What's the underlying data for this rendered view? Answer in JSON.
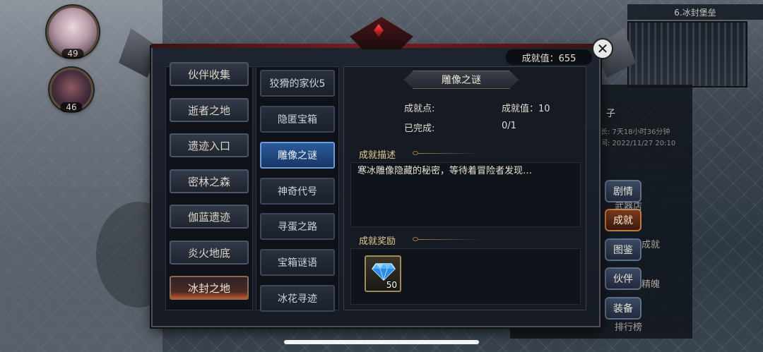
{
  "hud": {
    "avatar_levels": [
      "49",
      "46"
    ],
    "map_title": "6.冰封堡垒"
  },
  "side": {
    "partial_name": "子",
    "info_line1": "长: 7天18小时36分钟",
    "info_line2": "间: 2022/11/27 20:10",
    "buttons": [
      "剧情",
      "成就",
      "图鉴",
      "伙伴",
      "装备"
    ],
    "labels": [
      "武器店",
      "成就",
      "精魄",
      "排行榜"
    ]
  },
  "dialog": {
    "score": "成就值：655",
    "zones": [
      "伙伴收集",
      "逝者之地",
      "遗迹入口",
      "密林之森",
      "伽蓝遗迹",
      "炎火地底",
      "冰封之地"
    ],
    "achievements": [
      "狡猾的家伙5",
      "隐匿宝箱",
      "雕像之谜",
      "神奇代号",
      "寻蛋之路",
      "宝箱谜语",
      "冰花寻迹"
    ],
    "detail": {
      "title": "雕像之谜",
      "points_label": "成就点:",
      "points_value": "成就值：10",
      "completed_label": "已完成:",
      "completed_value": "0/1",
      "desc_label": "成就描述",
      "description": "寒冰雕像隐藏的秘密，等待着冒险者发现…",
      "reward_label": "成就奖励",
      "reward_count": "50"
    }
  }
}
